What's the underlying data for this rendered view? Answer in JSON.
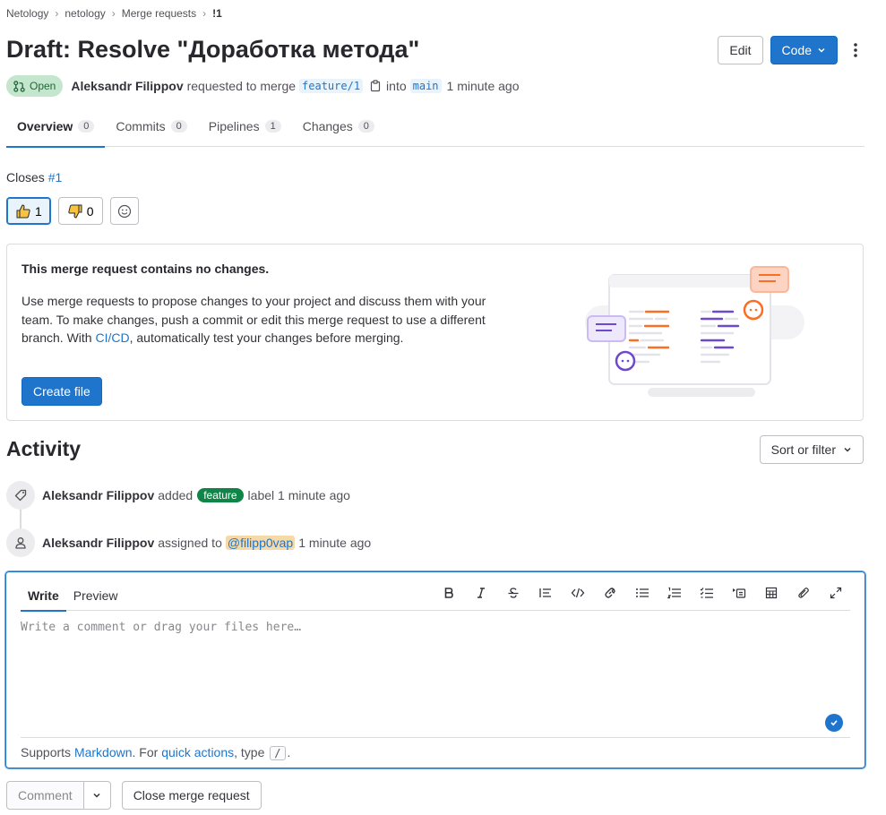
{
  "breadcrumb": [
    "Netology",
    "netology",
    "Merge requests",
    "!1"
  ],
  "title": "Draft: Resolve \"Доработка метода\"",
  "header": {
    "edit_label": "Edit",
    "code_label": "Code"
  },
  "meta": {
    "status": "Open",
    "author": "Aleksandr Filippov",
    "requested": "requested to merge",
    "source_branch": "feature/1",
    "into": "into",
    "target_branch": "main",
    "time": "1 minute ago"
  },
  "tabs": [
    {
      "label": "Overview",
      "count": "0"
    },
    {
      "label": "Commits",
      "count": "0"
    },
    {
      "label": "Pipelines",
      "count": "1"
    },
    {
      "label": "Changes",
      "count": "0"
    }
  ],
  "closes": {
    "prefix": "Closes",
    "issue": "#1"
  },
  "awards": {
    "thumbsup": "1",
    "thumbsdown": "0"
  },
  "empty_state": {
    "heading": "This merge request contains no changes.",
    "text_before": "Use merge requests to propose changes to your project and discuss them with your team. To make changes, push a commit or edit this merge request to use a different branch. With ",
    "link": "CI/CD",
    "text_after": ", automatically test your changes before merging.",
    "button": "Create file"
  },
  "activity": {
    "title": "Activity",
    "sort_label": "Sort or filter",
    "events": [
      {
        "who": "Aleksandr Filippov",
        "action": "added",
        "label": "feature",
        "suffix": "label 1 minute ago"
      },
      {
        "who": "Aleksandr Filippov",
        "action": "assigned to",
        "mention": "@filipp0vap",
        "suffix": "1 minute ago"
      }
    ]
  },
  "editor": {
    "tab_write": "Write",
    "tab_preview": "Preview",
    "placeholder": "Write a comment or drag your files here…",
    "footer_supports": "Supports",
    "footer_markdown": "Markdown",
    "footer_for": ". For",
    "footer_quick": "quick actions",
    "footer_type": ", type",
    "footer_kbd": "/",
    "footer_end": "."
  },
  "bottom": {
    "comment": "Comment",
    "close_mr": "Close merge request"
  },
  "colors": {
    "accent": "#1f75cb",
    "open_badge": "#c3e6cd",
    "label_feature": "#108548",
    "mention_bg": "#f5d9a8"
  }
}
